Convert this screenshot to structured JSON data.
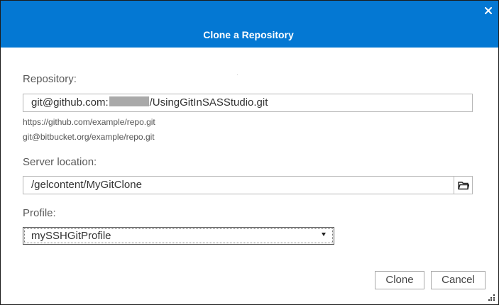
{
  "dialog": {
    "title": "Clone a Repository",
    "close_glyph": "✕"
  },
  "repository": {
    "label": "Repository:",
    "value_prefix": "git@github.com:",
    "value_suffix": "/UsingGitInSASStudio.git",
    "hint_https": "https://github.com/example/repo.git",
    "hint_ssh": "git@bitbucket.org/example/repo.git"
  },
  "server_location": {
    "label": "Server location:",
    "value": "/gelcontent/MyGitClone",
    "browse_icon": "folder-icon"
  },
  "profile": {
    "label": "Profile:",
    "selected": "mySSHGitProfile"
  },
  "buttons": {
    "clone": "Clone",
    "cancel": "Cancel"
  },
  "colors": {
    "header": "#0478d3",
    "header_text": "#ffffff",
    "label_text": "#595959"
  }
}
